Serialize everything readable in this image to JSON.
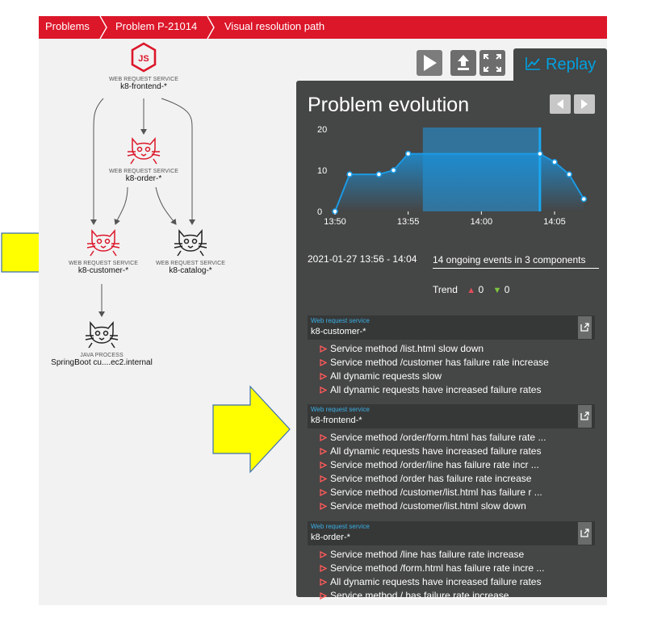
{
  "breadcrumb": {
    "items": [
      "Problems",
      "Problem P-21014",
      "Visual resolution path"
    ]
  },
  "topology": {
    "nodes": [
      {
        "id": "frontend",
        "type": "WEB REQUEST SERVICE",
        "name": "k8-frontend-*",
        "icon": "nodejs-icon",
        "highlighted": false
      },
      {
        "id": "order",
        "type": "WEB REQUEST SERVICE",
        "name": "k8-order-*",
        "icon": "tomcat-icon",
        "highlighted": true
      },
      {
        "id": "customer",
        "type": "WEB REQUEST SERVICE",
        "name": "k8-customer-*",
        "icon": "tomcat-icon",
        "highlighted": true
      },
      {
        "id": "catalog",
        "type": "WEB REQUEST SERVICE",
        "name": "k8-catalog-*",
        "icon": "tomcat-icon",
        "highlighted": false
      },
      {
        "id": "springboot",
        "type": "JAVA PROCESS",
        "name": "SpringBoot cu....ec2.internal",
        "icon": "tomcat-icon",
        "highlighted": false
      }
    ]
  },
  "toolbar": {
    "play": "play-icon",
    "export": "upload-icon",
    "fullscreen": "fullscreen-icon",
    "replay_label": "Replay"
  },
  "panel": {
    "title": "Problem evolution",
    "range": "2021-01-27 13:56 - 14:04",
    "events_summary": "14 ongoing events in 3 components",
    "trend_label": "Trend",
    "trend_up": "0",
    "trend_down": "0"
  },
  "chart_data": {
    "type": "line",
    "x": [
      "13:50",
      "13:51",
      "13:53",
      "13:54",
      "13:55",
      "14:04",
      "14:05",
      "14:06",
      "14:07"
    ],
    "values": [
      0,
      9,
      9,
      10,
      14,
      14,
      12,
      9,
      3
    ],
    "x_ticks": [
      "13:50",
      "13:55",
      "14:00",
      "14:05"
    ],
    "y_ticks": [
      "0",
      "10",
      "20"
    ],
    "ylim": [
      0,
      20
    ],
    "highlight_range": [
      "13:56",
      "14:04"
    ],
    "grid": false,
    "title": "",
    "xlabel": "",
    "ylabel": ""
  },
  "services": [
    {
      "type": "Web request service",
      "name": "k8-customer-*",
      "events": [
        "Service method /list.html slow down",
        "Service method /customer has failure rate increase",
        "All dynamic requests slow",
        "All dynamic requests have increased failure rates"
      ]
    },
    {
      "type": "Web request service",
      "name": "k8-frontend-*",
      "events": [
        "Service method /order/form.html has failure rate ...",
        "All dynamic requests have increased failure rates",
        "Service method /order/line has failure rate incr ...",
        "Service method /order has failure rate increase",
        "Service method /customer/list.html has failure r ...",
        "Service method /customer/list.html slow down"
      ]
    },
    {
      "type": "Web request service",
      "name": "k8-order-*",
      "events": [
        "Service method /line has failure rate increase",
        "Service method /form.html has failure rate incre ...",
        "All dynamic requests have increased failure rates",
        "Service method / has failure rate increase"
      ]
    }
  ],
  "colors": {
    "brand_red": "#dc172a",
    "panel_bg": "#454646",
    "accent_blue": "#00a1e0",
    "annotation_yellow": "#ffff00"
  }
}
